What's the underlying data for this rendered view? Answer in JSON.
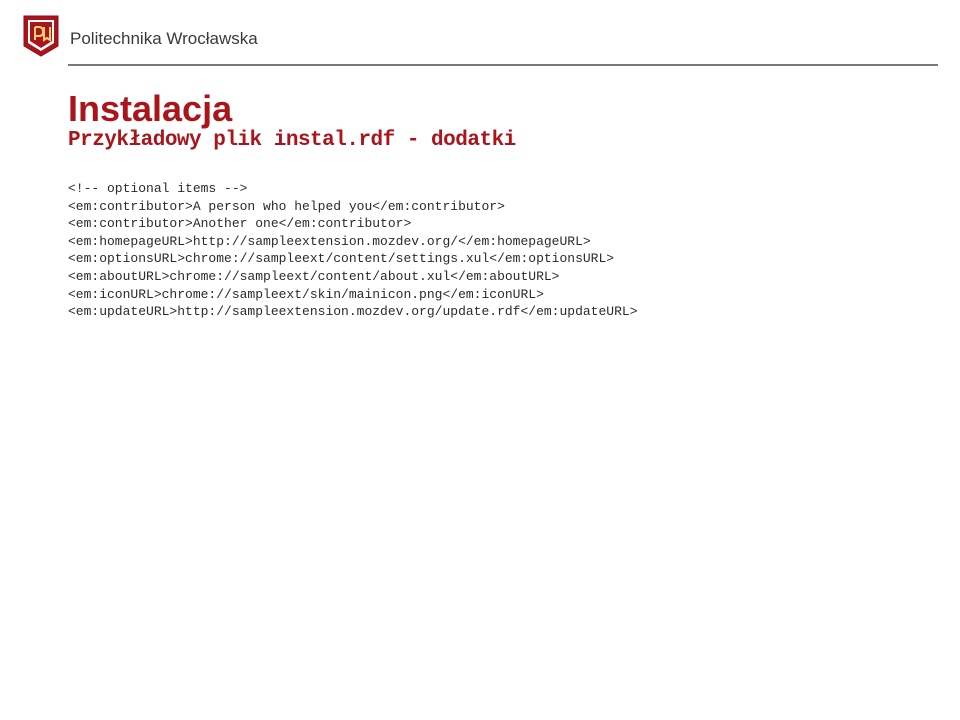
{
  "header": {
    "institution": "Politechnika Wrocławska"
  },
  "slide": {
    "title": "Instalacja",
    "subtitle": "Przykładowy plik instal.rdf - dodatki"
  },
  "code": {
    "l1": "<!-- optional items -->",
    "l2": "<em:contributor>A person who helped you</em:contributor>",
    "l3": "<em:contributor>Another one</em:contributor>",
    "l4": "<em:homepageURL>http://sampleextension.mozdev.org/</em:homepageURL>",
    "l5": "<em:optionsURL>chrome://sampleext/content/settings.xul</em:optionsURL>",
    "l6": "<em:aboutURL>chrome://sampleext/content/about.xul</em:aboutURL>",
    "l7": "<em:iconURL>chrome://sampleext/skin/mainicon.png</em:iconURL>",
    "l8": "<em:updateURL>http://sampleextension.mozdev.org/update.rdf</em:updateURL>"
  }
}
